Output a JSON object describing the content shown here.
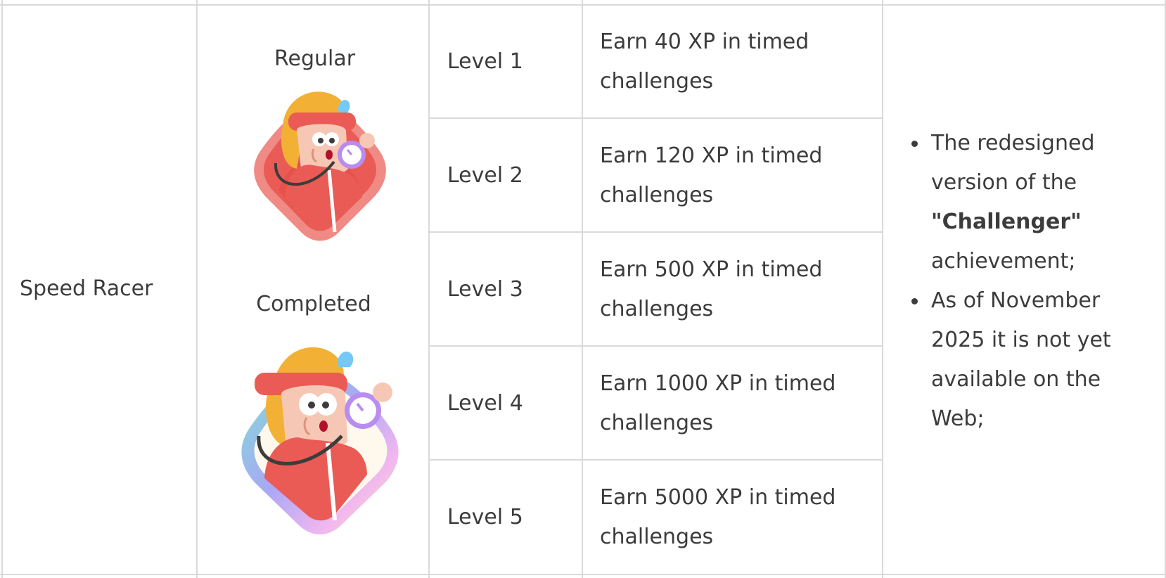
{
  "achievement": {
    "name": "Speed Racer",
    "badges": {
      "regular_label": "Regular",
      "completed_label": "Completed"
    },
    "levels": [
      {
        "level": "Level 1",
        "requirement_line1": "Earn 40 XP in timed",
        "requirement_line2": "challenges"
      },
      {
        "level": "Level 2",
        "requirement_line1": "Earn 120 XP in timed",
        "requirement_line2": "challenges"
      },
      {
        "level": "Level 3",
        "requirement_line1": "Earn 500 XP in timed",
        "requirement_line2": "challenges"
      },
      {
        "level": "Level 4",
        "requirement_line1": "Earn 1000 XP in timed",
        "requirement_line2": "challenges"
      },
      {
        "level": "Level 5",
        "requirement_line1": "Earn 5000 XP in timed",
        "requirement_line2": "challenges"
      }
    ],
    "notes": [
      {
        "line1": "The redesigned",
        "line2": "version of the",
        "bold": "\"Challenger\"",
        "line4": "achievement;"
      },
      {
        "line1": "As of November",
        "line2": "2025 it is not yet",
        "line3": "available on the",
        "line4": "Web;"
      }
    ]
  },
  "colors": {
    "border": "#dadada",
    "text": "#3c3c3c",
    "badge_red": "#ea5b55",
    "hair": "#f2b134",
    "stopwatch": "#b98cf0",
    "drop": "#74c9f6"
  },
  "icons": [
    "speed-racer-regular-badge-icon",
    "speed-racer-completed-badge-icon"
  ]
}
